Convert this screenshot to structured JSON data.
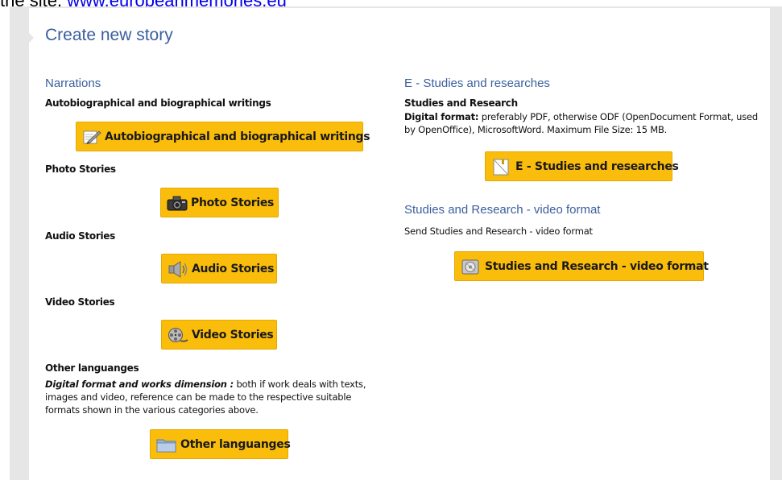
{
  "top_text": {
    "prefix": "the site, ",
    "link": "www.europeanmemories.eu"
  },
  "page_title": "Create new story",
  "left": {
    "heading": "Narrations",
    "items": [
      {
        "label": "Autobiographical and biographical writings",
        "button": "Autobiographical and biographical writings",
        "icon": "pencil-paper-icon"
      },
      {
        "label": "Photo Stories",
        "button": "Photo Stories",
        "icon": "camera-icon"
      },
      {
        "label": "Audio Stories",
        "button": "Audio Stories",
        "icon": "speaker-icon"
      },
      {
        "label": "Video Stories",
        "button": "Video Stories",
        "icon": "film-reel-icon"
      },
      {
        "label": "Other languanges",
        "button": "Other languanges",
        "icon": "folder-icon",
        "desc_lead": "Digital format and works dimension :",
        "desc_rest": " both if work deals with texts, images and video, reference can be made to the respective suitable formats shown in the various categories above."
      }
    ]
  },
  "right": {
    "sections": [
      {
        "heading": "E - Studies and researches",
        "label": "Studies and Research",
        "desc_lead": "Digital format:",
        "desc_rest": " preferably PDF, otherwise ODF (OpenDocument Format, used by OpenOffice), MicrosoftWord. Maximum File Size: 15 MB.",
        "button": "E - Studies and researches",
        "icon": "document-icon"
      },
      {
        "heading": "Studies and Research - video format",
        "desc": "Send Studies and Research - video format",
        "button": "Studies and Research - video format",
        "icon": "video-disc-icon"
      }
    ]
  },
  "colors": {
    "heading": "#3a5f9e",
    "button": "#fbbd0b",
    "frame": "#e6e6e6"
  }
}
